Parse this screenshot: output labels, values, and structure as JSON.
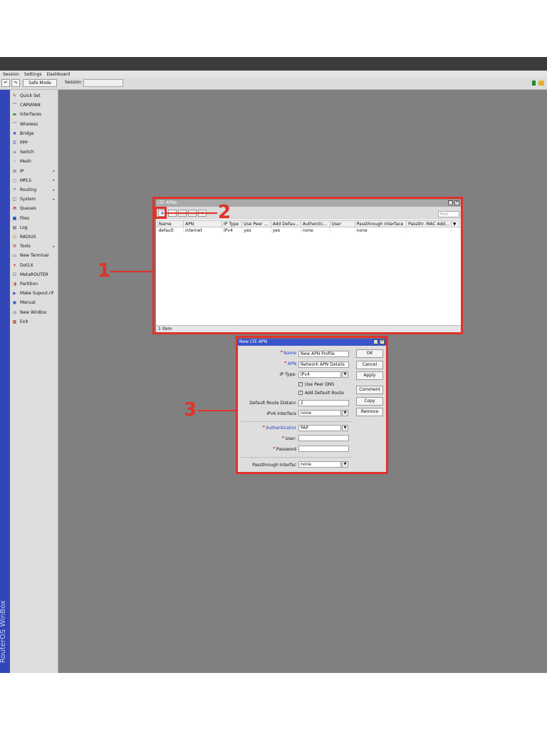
{
  "menu": [
    "Session",
    "Settings",
    "Dashboard"
  ],
  "toolbar": {
    "undo_icon": "undo-icon",
    "redo_icon": "redo-icon",
    "safe_mode": "Safe Mode",
    "session_label": "Session",
    "session_value": ""
  },
  "sidebar": {
    "brand": "RouterOS WinBox",
    "items": [
      {
        "label": "Quick Set",
        "icon": "wand-icon",
        "submenu": false
      },
      {
        "label": "CAPsMAN",
        "icon": "wifi-icon",
        "submenu": false
      },
      {
        "label": "Interfaces",
        "icon": "interface-icon",
        "submenu": false
      },
      {
        "label": "Wireless",
        "icon": "wifi-icon",
        "submenu": false
      },
      {
        "label": "Bridge",
        "icon": "bridge-icon",
        "submenu": false
      },
      {
        "label": "PPP",
        "icon": "ppp-icon",
        "submenu": false
      },
      {
        "label": "Switch",
        "icon": "switch-icon",
        "submenu": false
      },
      {
        "label": "Mesh",
        "icon": "mesh-icon",
        "submenu": false
      },
      {
        "label": "IP",
        "icon": "ip-icon",
        "submenu": true
      },
      {
        "label": "MPLS",
        "icon": "mpls-icon",
        "submenu": true
      },
      {
        "label": "Routing",
        "icon": "routing-icon",
        "submenu": true
      },
      {
        "label": "System",
        "icon": "system-icon",
        "submenu": true
      },
      {
        "label": "Queues",
        "icon": "queues-icon",
        "submenu": false
      },
      {
        "label": "Files",
        "icon": "folder-icon",
        "submenu": false
      },
      {
        "label": "Log",
        "icon": "log-icon",
        "submenu": false
      },
      {
        "label": "RADIUS",
        "icon": "users-icon",
        "submenu": false
      },
      {
        "label": "Tools",
        "icon": "tools-icon",
        "submenu": true
      },
      {
        "label": "New Terminal",
        "icon": "terminal-icon",
        "submenu": false
      },
      {
        "label": "Dot1X",
        "icon": "dot1x-icon",
        "submenu": false
      },
      {
        "label": "MetaROUTER",
        "icon": "metarouter-icon",
        "submenu": false
      },
      {
        "label": "Partition",
        "icon": "partition-icon",
        "submenu": false
      },
      {
        "label": "Make Supout.rif",
        "icon": "supout-icon",
        "submenu": false
      },
      {
        "label": "Manual",
        "icon": "manual-icon",
        "submenu": false
      },
      {
        "label": "New WinBox",
        "icon": "winbox-icon",
        "submenu": false
      },
      {
        "label": "Exit",
        "icon": "exit-icon",
        "submenu": false
      }
    ]
  },
  "lte_window": {
    "title": "LTE APNs",
    "find_placeholder": "Find",
    "columns": [
      "Name",
      "APN",
      "IP Type",
      "Use Peer ...",
      "Add Defau...",
      "Authentic...",
      "User",
      "Passthrough Interface",
      "Passthr. MAC Add..."
    ],
    "rows": [
      [
        "default",
        "internet",
        "IPv4",
        "yes",
        "yes",
        "none",
        "",
        "none",
        ""
      ]
    ],
    "status": "1 item"
  },
  "new_apn": {
    "title": "New LTE APN",
    "fields": {
      "name": {
        "label": "Name",
        "value": "New APN Profile"
      },
      "apn": {
        "label": "APN",
        "value": "Network APN Details"
      },
      "ip_type": {
        "label": "IP Type:",
        "value": "IPv4"
      },
      "use_peer_dns": {
        "label": "Use Peer DNS",
        "checked": true
      },
      "add_default_route": {
        "label": "Add Default Route",
        "checked": true
      },
      "default_route_distance": {
        "label": "Default Route Distanc",
        "value": "2"
      },
      "ipv6_interface": {
        "label": "IPv6 Interface",
        "value": "none"
      },
      "authentication": {
        "label": "Authenticatior",
        "value": "PAP"
      },
      "user": {
        "label": "User:",
        "value": ""
      },
      "password": {
        "label": "Password",
        "value": ""
      },
      "passthrough_interface": {
        "label": "Passthrough Interfac",
        "value": "none"
      }
    },
    "buttons": [
      "OK",
      "Cancel",
      "Apply",
      "Comment",
      "Copy",
      "Remove"
    ]
  },
  "annotations": {
    "one": "1",
    "two": "2",
    "three": "3"
  },
  "colors": {
    "highlight": "#e0322a",
    "sidebar_blue": "#3346b8",
    "desktop": "#808080",
    "dialog_title": "#3a55c9",
    "required": "#d01c1c",
    "blue_label": "#1f3ed0"
  }
}
